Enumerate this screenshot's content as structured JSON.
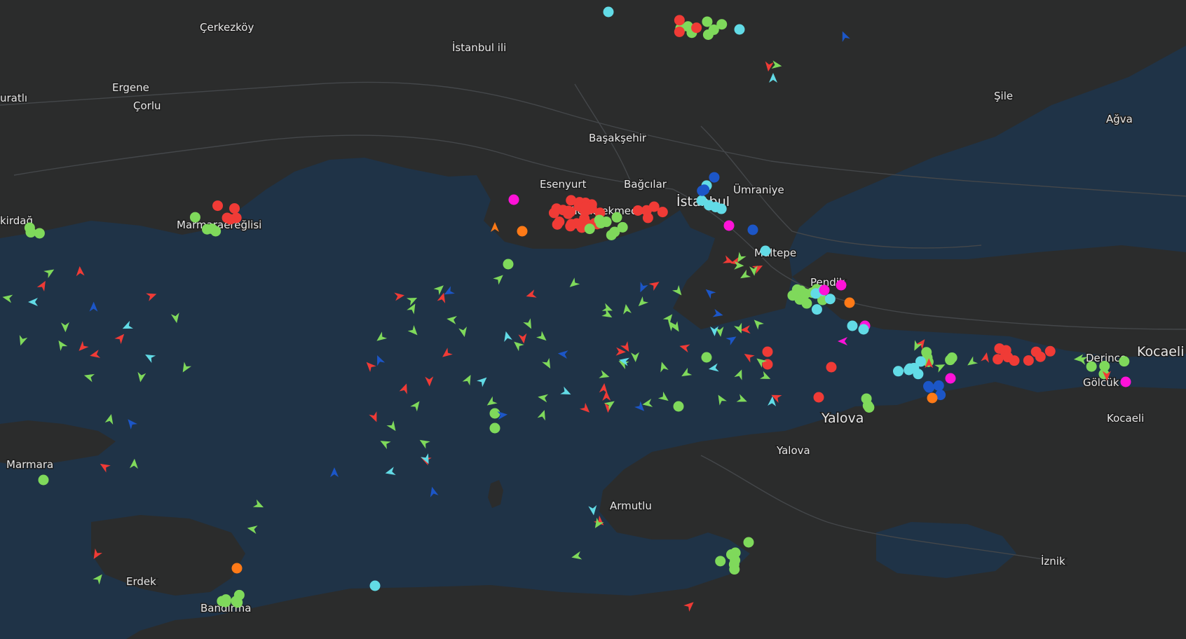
{
  "map": {
    "colors": {
      "sea": "#1f3347",
      "land": "#2b2c2c",
      "roads": "#44474a",
      "label": "#e6e6e6",
      "cargo": "#7fd95b",
      "tanker": "#f03b36",
      "passenger": "#1c56c7",
      "tug_special": "#62dbe6",
      "pleasure": "#ff12d8",
      "fishing": "#ff7a17"
    },
    "places": [
      {
        "name": "Çerkezköy",
        "size": "normal"
      },
      {
        "name": "İstanbul ili",
        "size": "normal"
      },
      {
        "name": "Şile",
        "size": "normal"
      },
      {
        "name": "Ağva",
        "size": "normal"
      },
      {
        "name": "uratlı",
        "size": "normal"
      },
      {
        "name": "Ergene",
        "size": "normal"
      },
      {
        "name": "Çorlu",
        "size": "normal"
      },
      {
        "name": "Başakşehir",
        "size": "normal"
      },
      {
        "name": "Esenyurt",
        "size": "normal"
      },
      {
        "name": "Bağcılar",
        "size": "normal"
      },
      {
        "name": "Küçükçekmece",
        "size": "normal"
      },
      {
        "name": "İstanbul",
        "size": "big"
      },
      {
        "name": "Ümraniye",
        "size": "normal"
      },
      {
        "name": "Maltepe",
        "size": "normal"
      },
      {
        "name": "Pendik",
        "size": "normal"
      },
      {
        "name": "kirdağ",
        "size": "normal"
      },
      {
        "name": "Marmaraereğlisi",
        "size": "normal"
      },
      {
        "name": "Kocaeli",
        "size": "big"
      },
      {
        "name": "Derince",
        "size": "normal"
      },
      {
        "name": "Gölcük",
        "size": "normal"
      },
      {
        "name": "Kocaeli",
        "size": "normal"
      },
      {
        "name": "Yalova",
        "size": "big"
      },
      {
        "name": "Yalova",
        "size": "normal"
      },
      {
        "name": "Marmara",
        "size": "normal"
      },
      {
        "name": "Armutlu",
        "size": "normal"
      },
      {
        "name": "Erdek",
        "size": "normal"
      },
      {
        "name": "Bandırma",
        "size": "normal"
      },
      {
        "name": "İznik",
        "size": "normal"
      }
    ]
  }
}
